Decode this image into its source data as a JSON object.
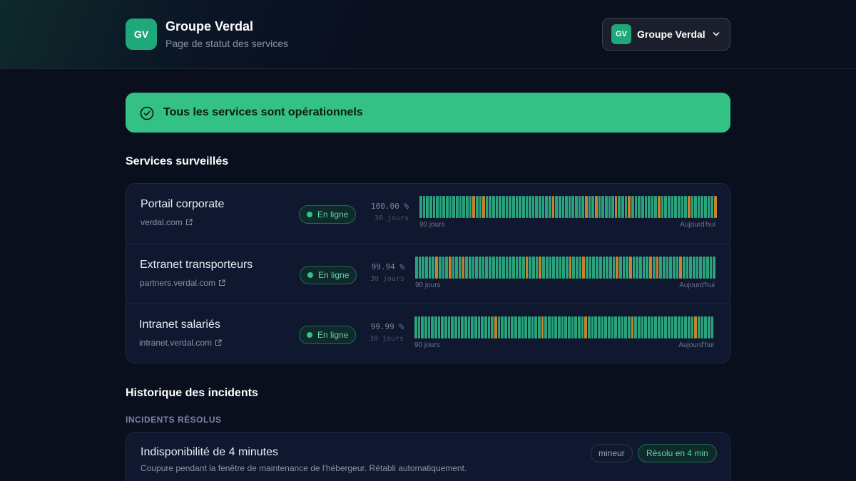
{
  "header": {
    "logo_initials": "GV",
    "title": "Groupe Verdal",
    "subtitle": "Page de statut des services",
    "org_switcher": {
      "initials": "GV",
      "name": "Groupe Verdal",
      "icon": "chevron-down-icon"
    }
  },
  "banner": {
    "text": "Tous les services sont opérationnels",
    "icon": "check-circle-icon",
    "color": "#34c185"
  },
  "services_section": {
    "title": "Services surveillés",
    "items": [
      {
        "name": "Portail corporate",
        "url": "verdal.com",
        "status": "En ligne",
        "uptime": "100.00 %",
        "uptime_period": "30 jours",
        "range_start": "90 jours",
        "range_end": "Aujourd'hui"
      },
      {
        "name": "Extranet transporteurs",
        "url": "partners.verdal.com",
        "status": "En ligne",
        "uptime": "99.94 %",
        "uptime_period": "30 jours",
        "range_start": "90 jours",
        "range_end": "Aujourd'hui"
      },
      {
        "name": "Intranet salariés",
        "url": "intranet.verdal.com",
        "status": "En ligne",
        "uptime": "99.99 %",
        "uptime_period": "30 jours",
        "range_start": "90 jours",
        "range_end": "Aujourd'hui"
      }
    ],
    "colors": {
      "operational": "#2aa37c",
      "degraded": "#c8822b"
    }
  },
  "incidents_section": {
    "title": "Historique des incidents",
    "resolved_label": "INCIDENTS RÉSOLUS",
    "items": [
      {
        "title": "Indisponibilité de 4 minutes",
        "description": "Coupure pendant la fenêtre de maintenance de l'hébergeur. Rétabli automatiquement.",
        "severity": "mineur",
        "resolution": "Résolu en 4 min"
      }
    ]
  }
}
